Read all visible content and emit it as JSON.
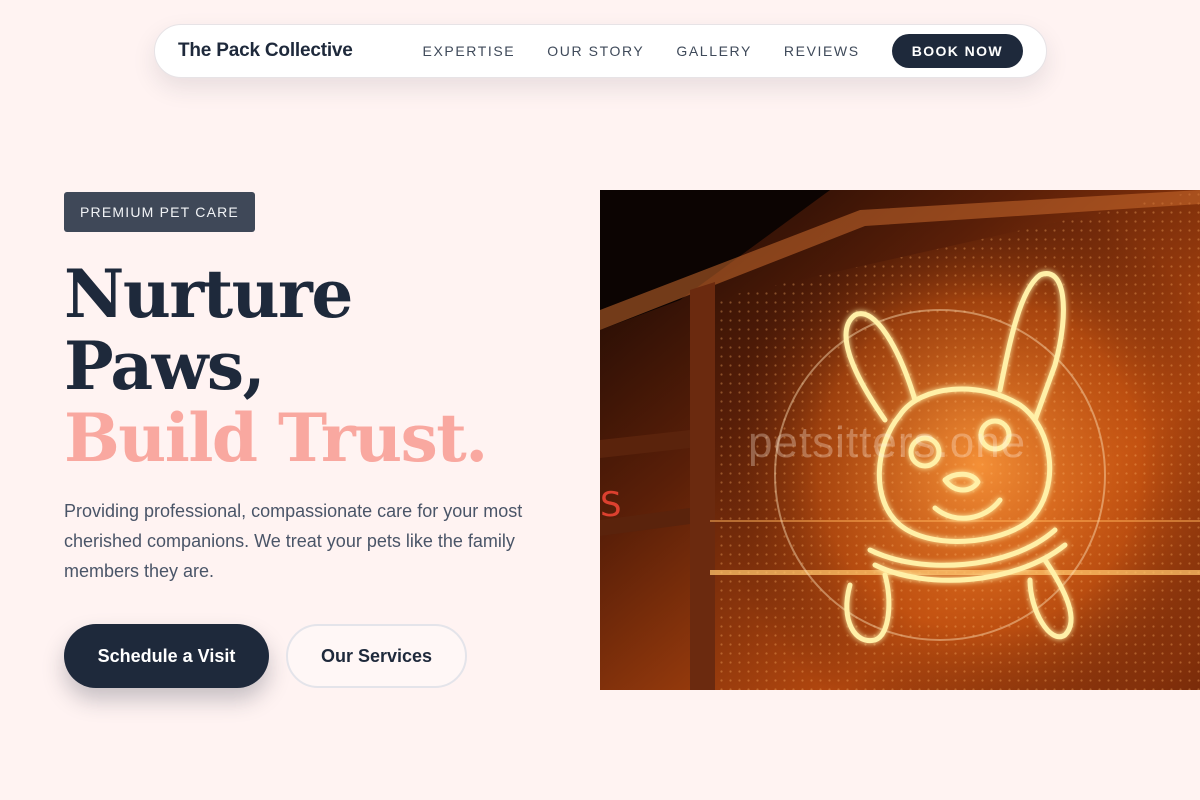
{
  "nav": {
    "brand": "The Pack Collective",
    "links": [
      {
        "label": "EXPERTISE"
      },
      {
        "label": "OUR STORY"
      },
      {
        "label": "GALLERY"
      },
      {
        "label": "REVIEWS"
      }
    ],
    "cta_label": "BOOK NOW"
  },
  "hero": {
    "badge": "PREMIUM PET CARE",
    "headline": {
      "line1": "Nurture",
      "line2": "Paws,",
      "accent": "Build Trust."
    },
    "description": "Providing professional, compassionate care for your most cherished companions. We treat your pets like the family members they are.",
    "primary_button": "Schedule a Visit",
    "secondary_button": "Our Services",
    "image": {
      "watermark": "petsitters.one",
      "icon": "neon-dog-astronaut-sign"
    }
  },
  "colors": {
    "background": "#fff3f2",
    "navy": "#1e293b",
    "accent_pink": "#f9a8a0",
    "neon_glow": "#ffd27a"
  }
}
